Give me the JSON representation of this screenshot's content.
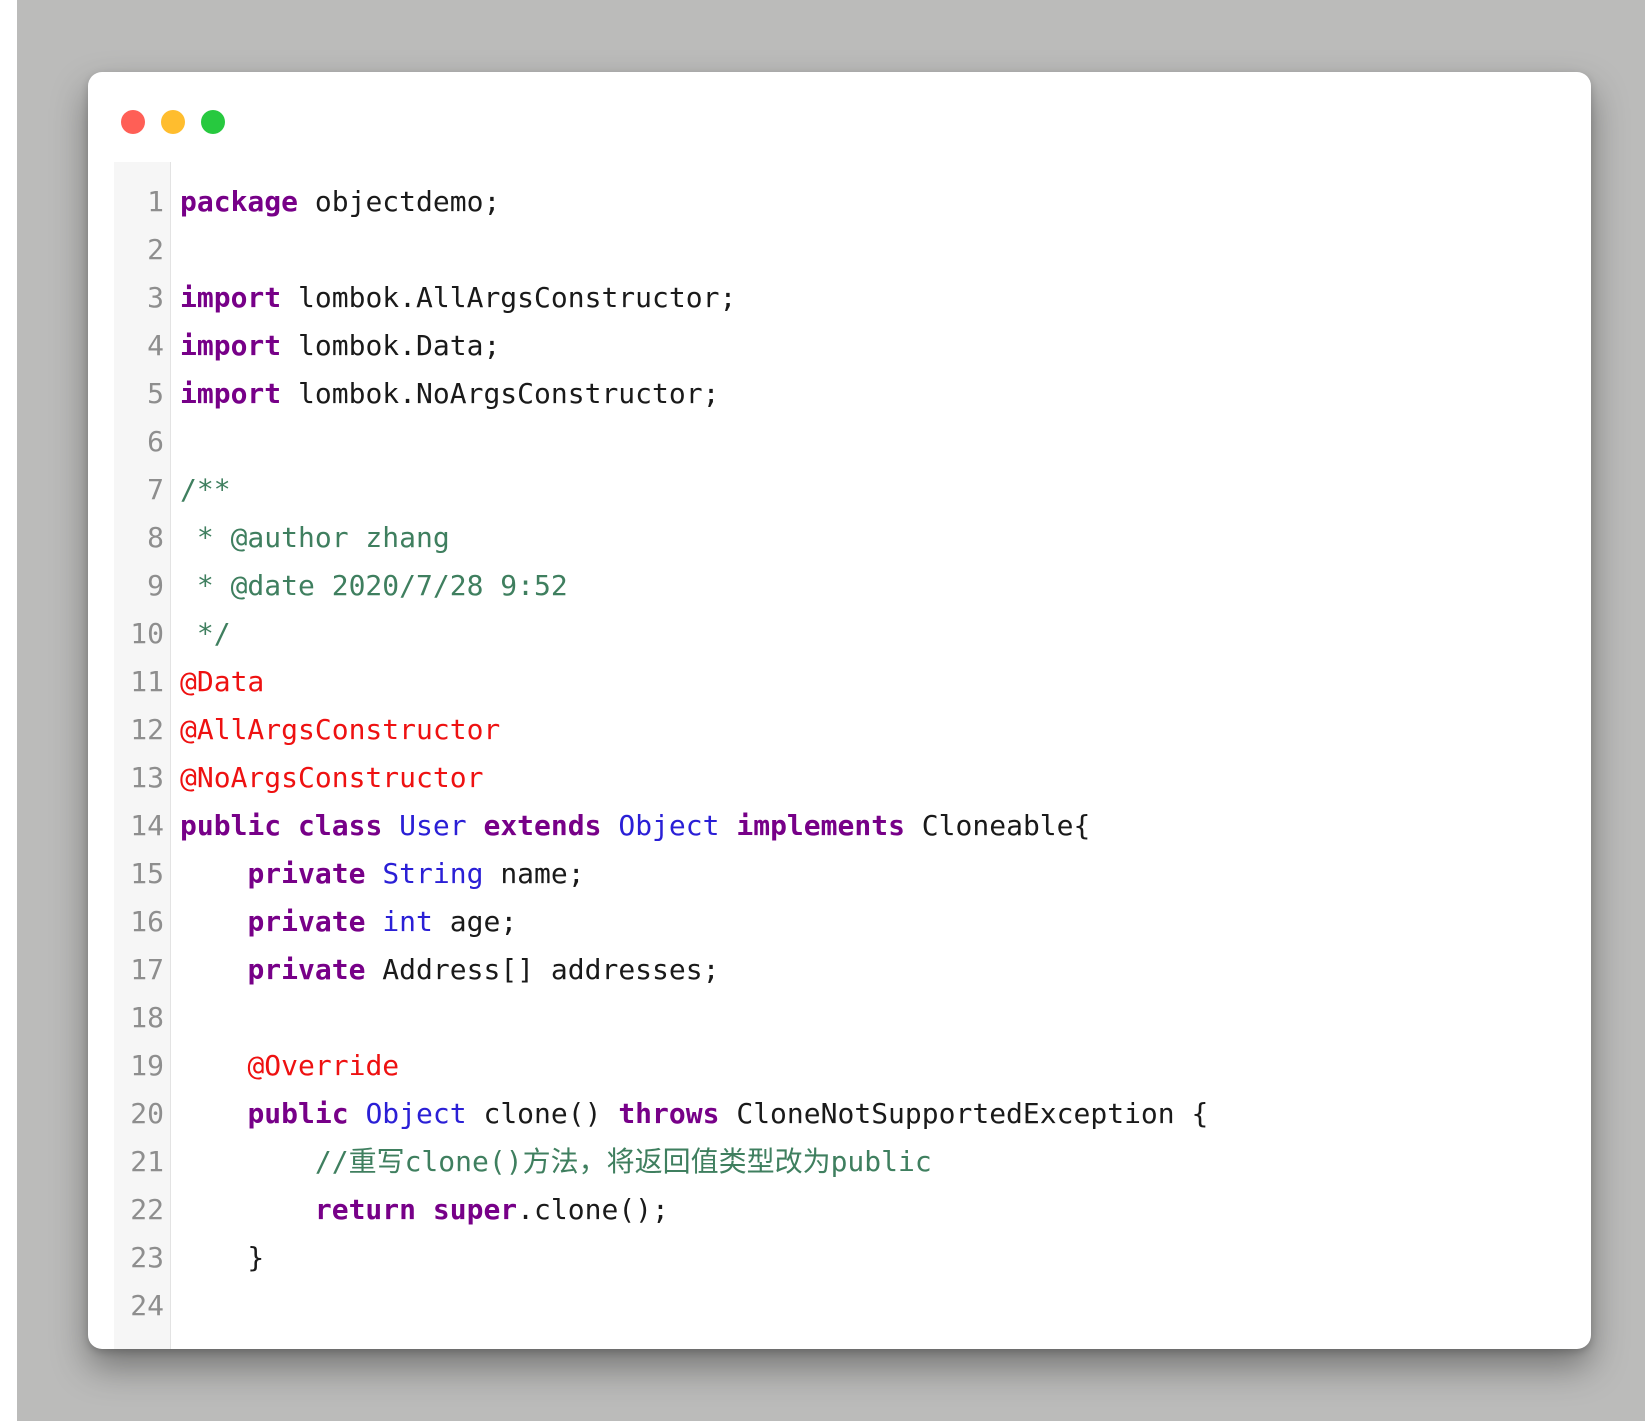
{
  "window": {
    "controls": [
      "close",
      "minimize",
      "zoom"
    ],
    "colors": {
      "close": "#ff5f56",
      "minimize": "#ffbd2e",
      "zoom": "#27c93f"
    }
  },
  "code": {
    "language": "java",
    "lines": [
      {
        "n": "1",
        "tokens": [
          {
            "t": "package",
            "c": "kw"
          },
          {
            "t": " objectdemo;",
            "c": "plain"
          }
        ]
      },
      {
        "n": "2",
        "tokens": []
      },
      {
        "n": "3",
        "tokens": [
          {
            "t": "import",
            "c": "kw"
          },
          {
            "t": " lombok.AllArgsConstructor;",
            "c": "plain"
          }
        ]
      },
      {
        "n": "4",
        "tokens": [
          {
            "t": "import",
            "c": "kw"
          },
          {
            "t": " lombok.Data;",
            "c": "plain"
          }
        ]
      },
      {
        "n": "5",
        "tokens": [
          {
            "t": "import",
            "c": "kw"
          },
          {
            "t": " lombok.NoArgsConstructor;",
            "c": "plain"
          }
        ]
      },
      {
        "n": "6",
        "tokens": []
      },
      {
        "n": "7",
        "tokens": [
          {
            "t": "/**",
            "c": "comment"
          }
        ]
      },
      {
        "n": "8",
        "tokens": [
          {
            "t": " * @author zhang",
            "c": "comment"
          }
        ]
      },
      {
        "n": "9",
        "tokens": [
          {
            "t": " * @date 2020/7/28 9:52",
            "c": "comment"
          }
        ]
      },
      {
        "n": "10",
        "tokens": [
          {
            "t": " */",
            "c": "comment"
          }
        ]
      },
      {
        "n": "11",
        "tokens": [
          {
            "t": "@Data",
            "c": "anno"
          }
        ]
      },
      {
        "n": "12",
        "tokens": [
          {
            "t": "@AllArgsConstructor",
            "c": "anno"
          }
        ]
      },
      {
        "n": "13",
        "tokens": [
          {
            "t": "@NoArgsConstructor",
            "c": "anno"
          }
        ]
      },
      {
        "n": "14",
        "tokens": [
          {
            "t": "public",
            "c": "kw"
          },
          {
            "t": " ",
            "c": "plain"
          },
          {
            "t": "class",
            "c": "kw"
          },
          {
            "t": " ",
            "c": "plain"
          },
          {
            "t": "User",
            "c": "type"
          },
          {
            "t": " ",
            "c": "plain"
          },
          {
            "t": "extends",
            "c": "kw"
          },
          {
            "t": " ",
            "c": "plain"
          },
          {
            "t": "Object",
            "c": "type"
          },
          {
            "t": " ",
            "c": "plain"
          },
          {
            "t": "implements",
            "c": "kw"
          },
          {
            "t": " Cloneable{",
            "c": "plain"
          }
        ]
      },
      {
        "n": "15",
        "tokens": [
          {
            "t": "    ",
            "c": "plain"
          },
          {
            "t": "private",
            "c": "kw"
          },
          {
            "t": " ",
            "c": "plain"
          },
          {
            "t": "String",
            "c": "type"
          },
          {
            "t": " name;",
            "c": "plain"
          }
        ]
      },
      {
        "n": "16",
        "tokens": [
          {
            "t": "    ",
            "c": "plain"
          },
          {
            "t": "private",
            "c": "kw"
          },
          {
            "t": " ",
            "c": "plain"
          },
          {
            "t": "int",
            "c": "type"
          },
          {
            "t": " age;",
            "c": "plain"
          }
        ]
      },
      {
        "n": "17",
        "tokens": [
          {
            "t": "    ",
            "c": "plain"
          },
          {
            "t": "private",
            "c": "kw"
          },
          {
            "t": " Address[] addresses;",
            "c": "plain"
          }
        ]
      },
      {
        "n": "18",
        "tokens": []
      },
      {
        "n": "19",
        "tokens": [
          {
            "t": "    ",
            "c": "plain"
          },
          {
            "t": "@Override",
            "c": "anno"
          }
        ]
      },
      {
        "n": "20",
        "tokens": [
          {
            "t": "    ",
            "c": "plain"
          },
          {
            "t": "public",
            "c": "kw"
          },
          {
            "t": " ",
            "c": "plain"
          },
          {
            "t": "Object",
            "c": "type"
          },
          {
            "t": " clone() ",
            "c": "plain"
          },
          {
            "t": "throws",
            "c": "kw"
          },
          {
            "t": " CloneNotSupportedException {",
            "c": "plain"
          }
        ]
      },
      {
        "n": "21",
        "tokens": [
          {
            "t": "        ",
            "c": "plain"
          },
          {
            "t": "//重写clone()方法，将返回值类型改为public",
            "c": "comment"
          }
        ]
      },
      {
        "n": "22",
        "tokens": [
          {
            "t": "        ",
            "c": "plain"
          },
          {
            "t": "return",
            "c": "kw"
          },
          {
            "t": " ",
            "c": "plain"
          },
          {
            "t": "super",
            "c": "kw"
          },
          {
            "t": ".clone();",
            "c": "plain"
          }
        ]
      },
      {
        "n": "23",
        "tokens": [
          {
            "t": "    }",
            "c": "plain"
          }
        ]
      },
      {
        "n": "24",
        "tokens": []
      }
    ]
  }
}
